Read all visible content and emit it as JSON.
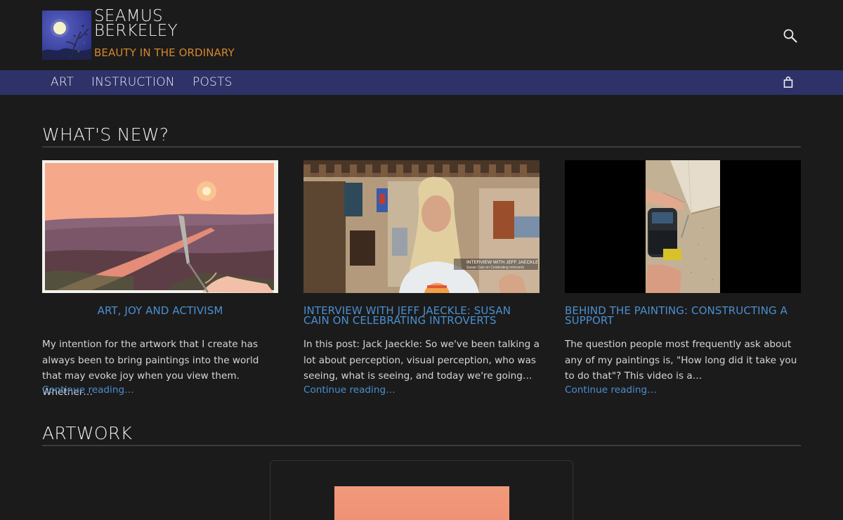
{
  "site": {
    "title_line1": "SEAMUS",
    "title_line2": "BERKELEY",
    "tagline": "BEAUTY IN THE ORDINARY",
    "logo_icon": "moon-painting-logo",
    "search_icon": "search-icon"
  },
  "nav": {
    "items": [
      {
        "label": "ART"
      },
      {
        "label": "INSTRUCTION"
      },
      {
        "label": "POSTS"
      }
    ],
    "cart_icon": "shopping-bag-icon"
  },
  "whats_new": {
    "heading": "WHAT'S NEW?",
    "posts": [
      {
        "title": "ART, JOY AND ACTIVISM",
        "excerpt": "My intention for the artwork that I create has always been to bring paintings into the world that may evoke joy when you view them. Whether…",
        "continue": "Continue reading…"
      },
      {
        "title": "INTERVIEW WITH JEFF JAECKLE: SUSAN CAIN ON CELEBRATING INTROVERTS",
        "excerpt": "In this post: Jack Jaeckle: So we've been talking a lot about perception, visual perception, who was seeing, what is seeing, and today we're going…",
        "continue": "Continue reading…",
        "video_caption_line1": "INTERVIEW WITH JEFF JAECKLE",
        "video_caption_line2": "Susan Cain on Celebrating Introverts"
      },
      {
        "title": "BEHIND THE PAINTING: CONSTRUCTING A SUPPORT",
        "excerpt": "The question people most frequently ask about any of my paintings is, \"How long did it take you to do that\"? This video is a…",
        "continue": "Continue reading…"
      }
    ]
  },
  "artwork": {
    "heading": "ARTWORK"
  },
  "colors": {
    "background": "#1b1b1b",
    "nav_bar": "#2e3269",
    "tagline": "#d4872d",
    "link": "#4a8fd0"
  }
}
